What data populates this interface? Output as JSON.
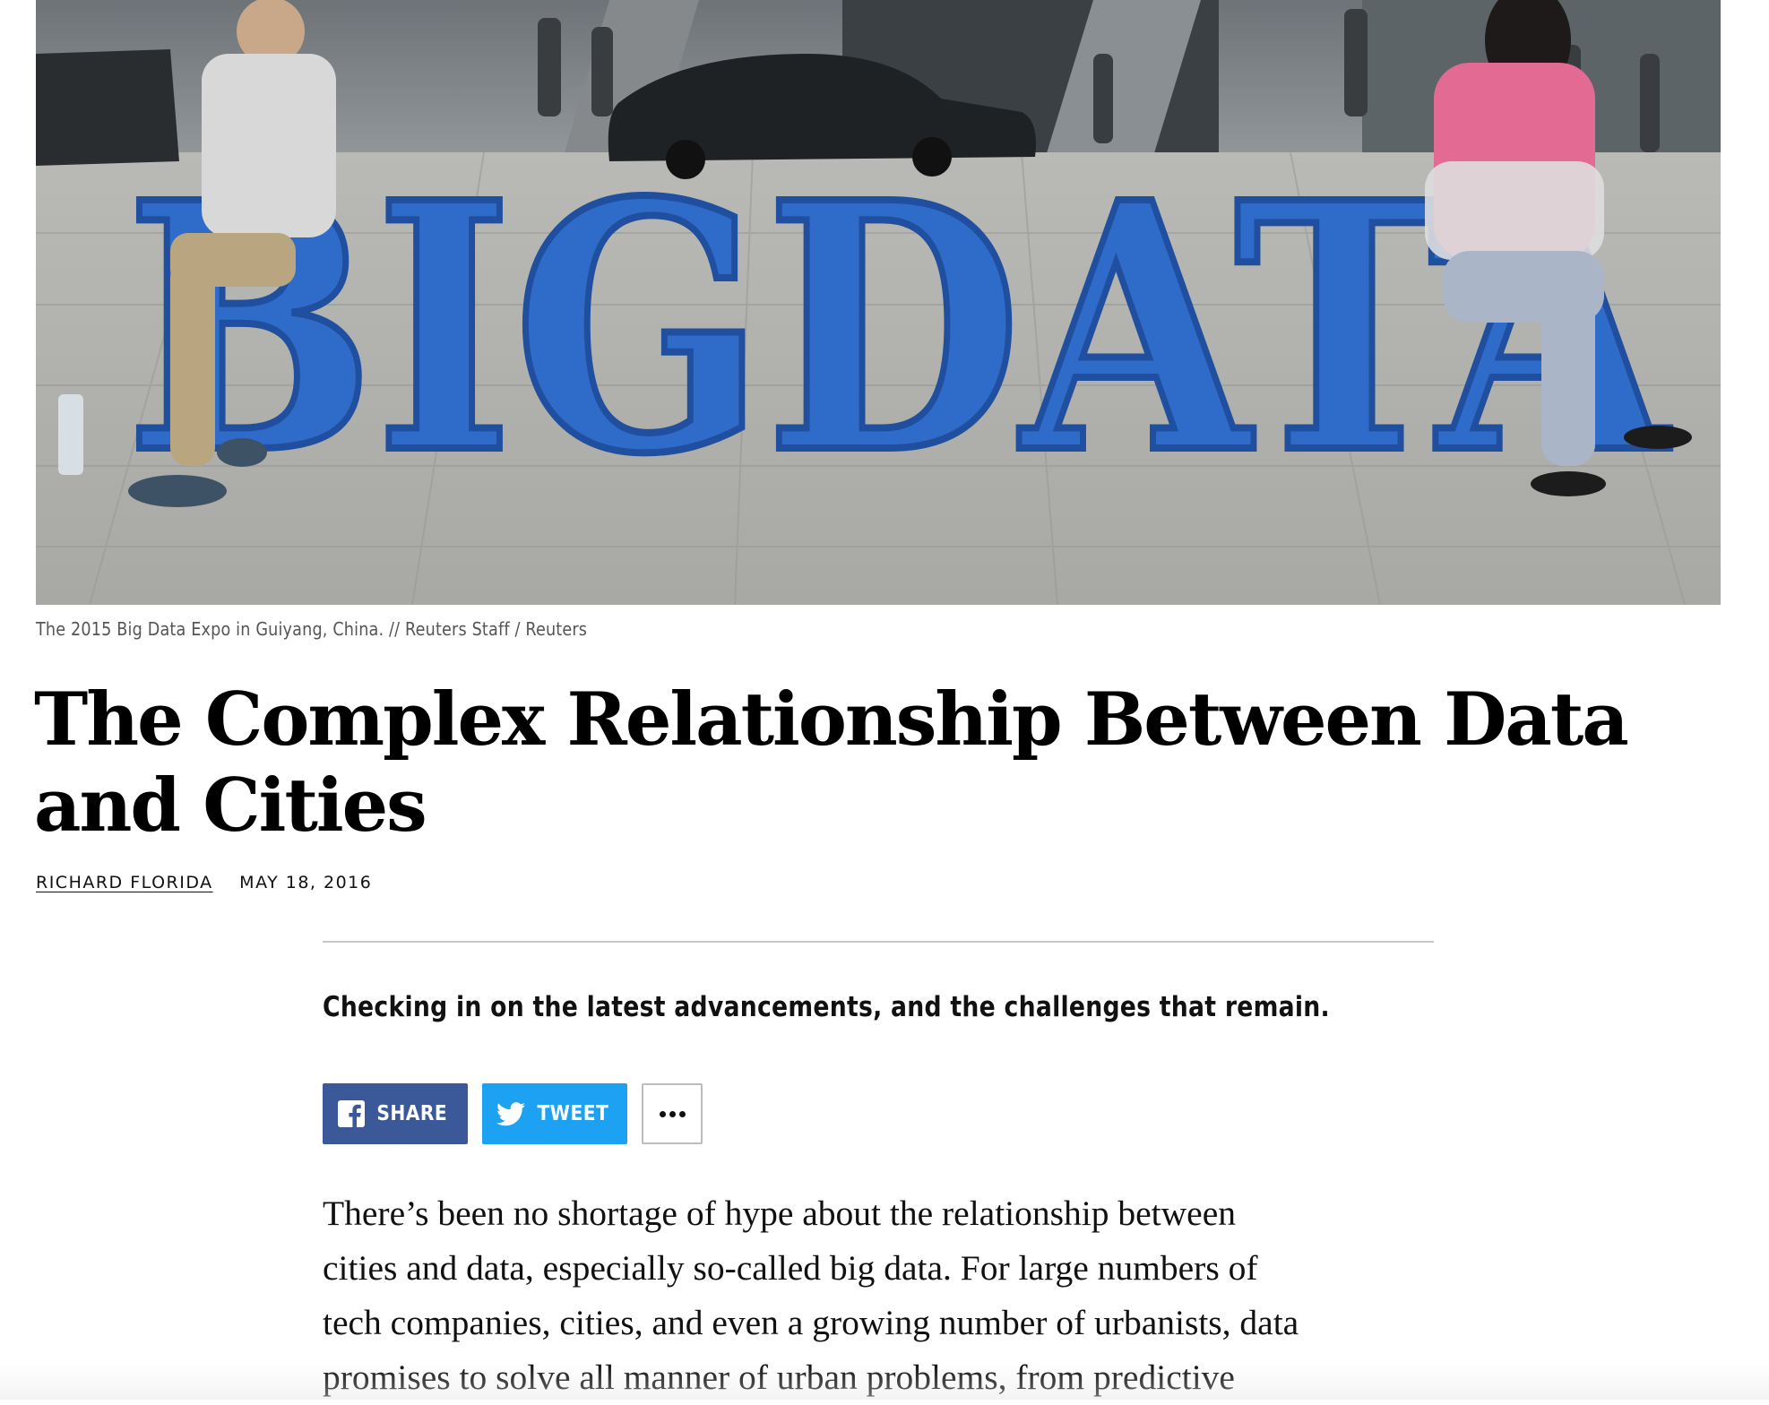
{
  "hero": {
    "sculpture_text": "BIGDATA",
    "sculpture_color": "#2f6bc8",
    "caption": "The 2015 Big Data Expo in Guiyang, China. // Reuters Staff / Reuters"
  },
  "article": {
    "title": "The Complex Relationship Between Data and Cities",
    "author": "RICHARD FLORIDA",
    "date": "MAY 18, 2016",
    "dek": "Checking in on the latest advancements, and the challenges that remain.",
    "body_lines": [
      "There’s been no shortage of hype about the relationship between",
      "cities and data, especially so-called big data. For large numbers of",
      "tech companies, cities, and even a growing number of urbanists, data",
      "promises to solve all manner of urban problems, from predictive"
    ]
  },
  "share": {
    "facebook_label": "SHARE",
    "twitter_label": "TWEET",
    "more_icon": "ellipsis-icon",
    "facebook_color": "#3b5998",
    "twitter_color": "#1da1f2"
  }
}
